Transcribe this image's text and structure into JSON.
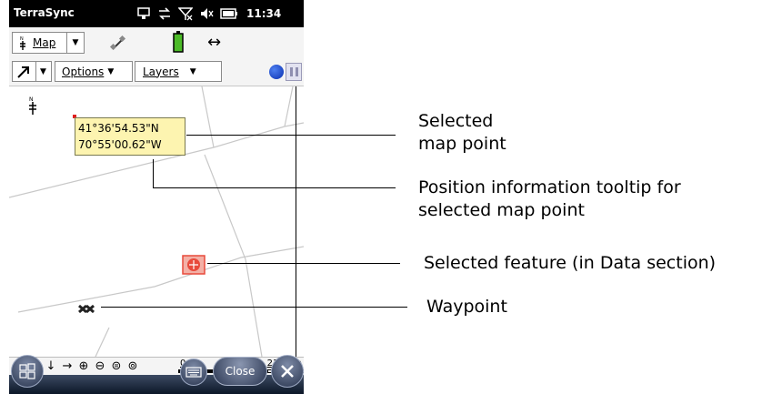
{
  "titlebar": {
    "app_name": "TerraSync",
    "time": "11:34"
  },
  "map_section": {
    "label": "Map",
    "swap_symbol": "↔"
  },
  "toolbar": {
    "options_label": "Options",
    "layers_label": "Layers"
  },
  "coordinates": {
    "latitude": "41°36'54.53\"N",
    "longitude": "70°55'00.62\"W"
  },
  "navigation": {
    "buttons": [
      "←",
      "↑",
      "↓",
      "→",
      "⊕",
      "⊖",
      "⊜",
      "⊚"
    ]
  },
  "scale_bar": {
    "start": "0",
    "end": "215.2m"
  },
  "softkeys": {
    "close_label": "Close"
  },
  "callouts": {
    "selected_point": [
      "Selected",
      "map point"
    ],
    "tooltip": [
      "Position information tooltip for",
      "selected map point"
    ],
    "feature": "Selected feature (in Data section)",
    "waypoint": "Waypoint"
  },
  "colors": {
    "tooltip_bg": "#fdf4b0",
    "feature_red": "#e84a3c",
    "titlebar": "#000000",
    "record_blue": "#1a4fd6"
  }
}
